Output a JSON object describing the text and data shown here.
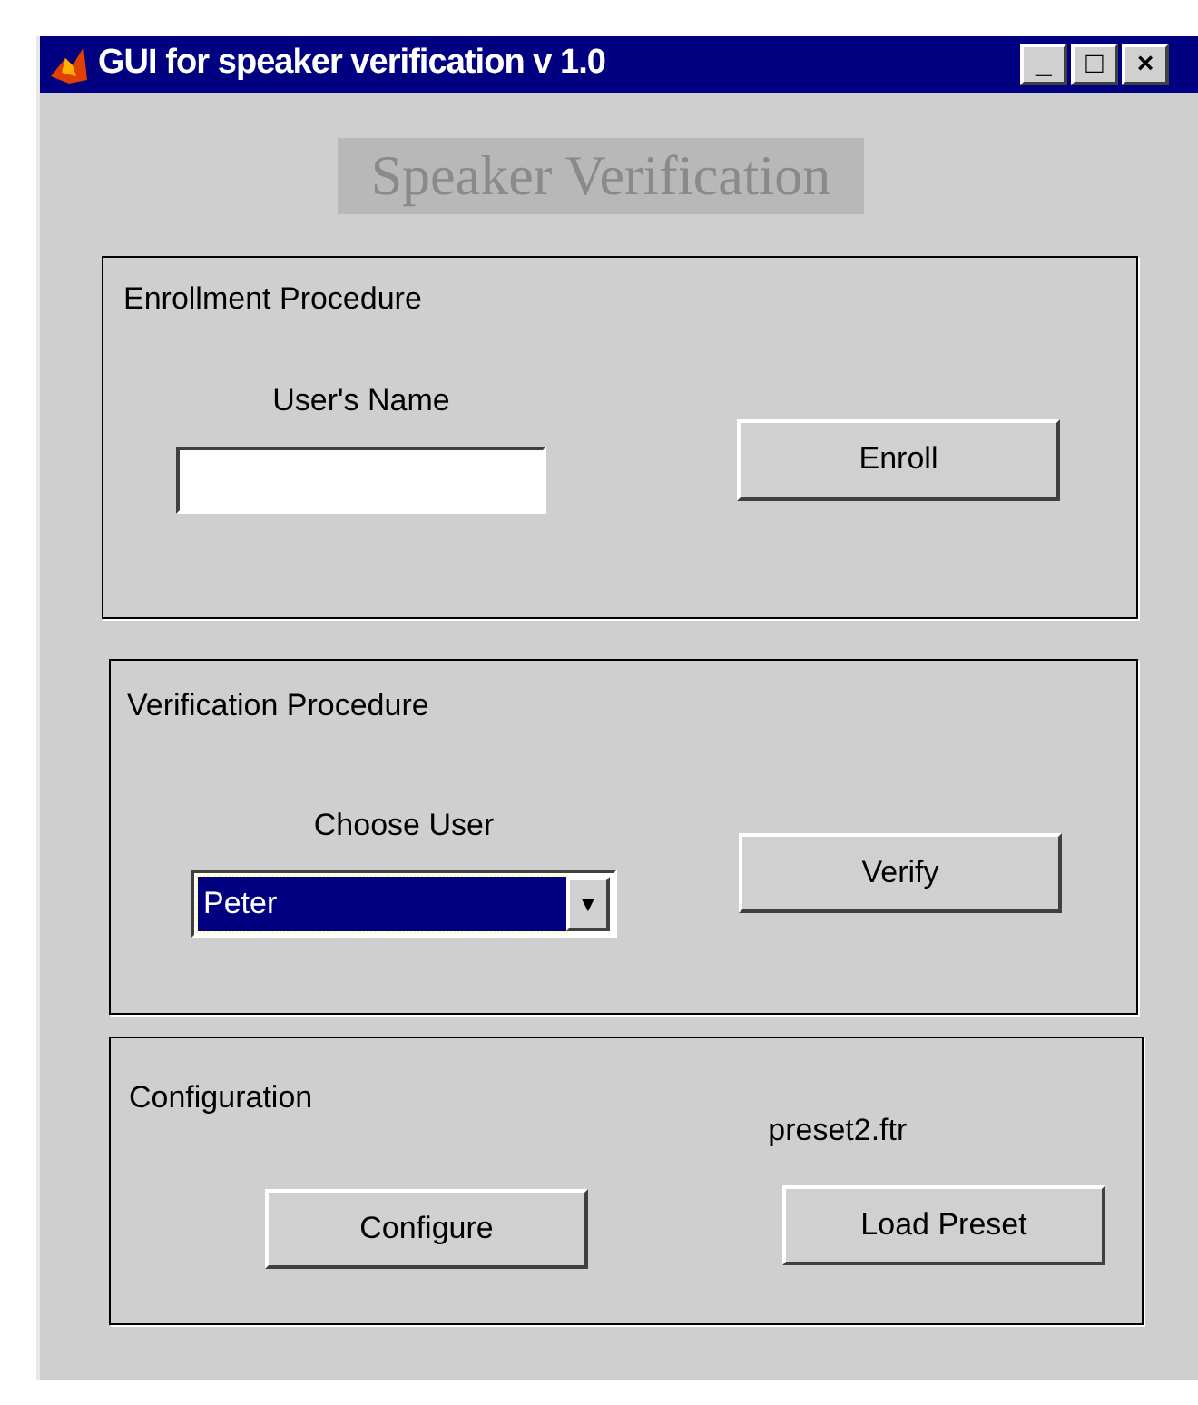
{
  "window": {
    "title": "GUI for speaker verification v 1.0",
    "controls": [
      "_",
      "□",
      "×"
    ]
  },
  "heading": "Speaker Verification",
  "enrollment": {
    "title": "Enrollment Procedure",
    "label": "User's Name",
    "button": "Enroll"
  },
  "verification": {
    "title": "Verification Procedure",
    "label": "Choose User",
    "selected_user": "Peter",
    "arrow": "▼",
    "button": "Verify"
  },
  "configuration": {
    "title": "Configuration",
    "preset_file": "preset2.ftr",
    "buttons": [
      "Configure",
      "Load Preset"
    ]
  }
}
